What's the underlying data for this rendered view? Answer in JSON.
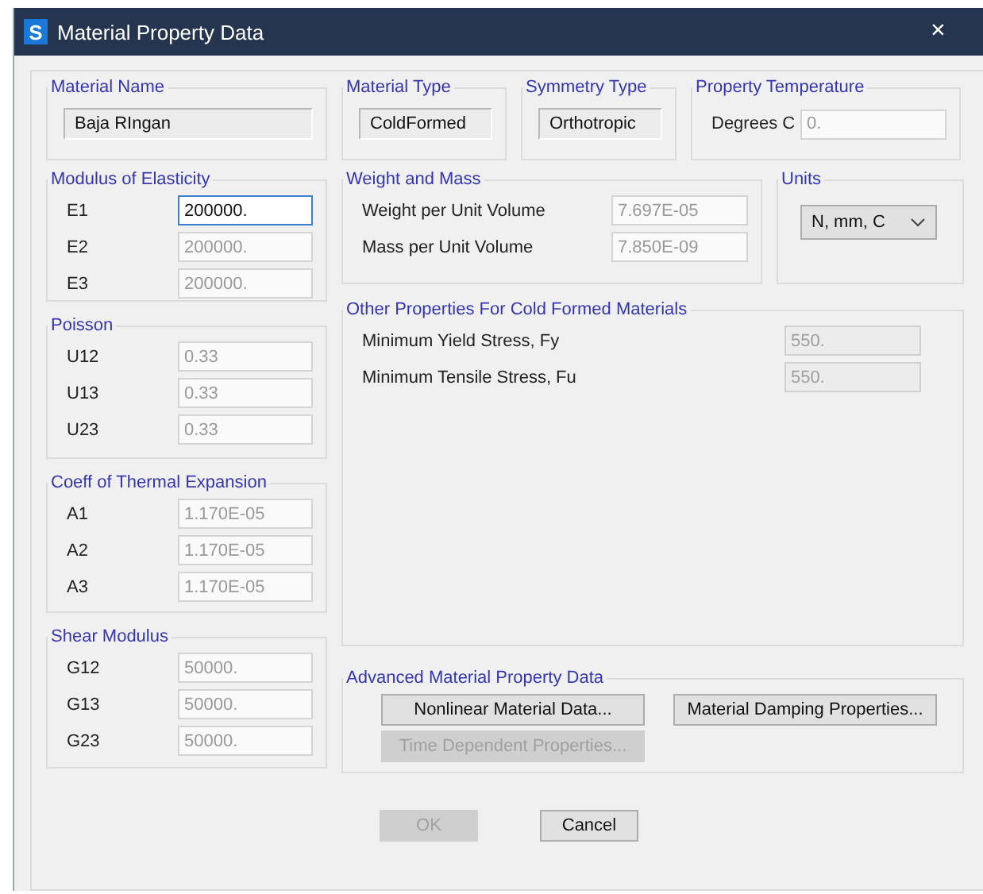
{
  "window": {
    "title": "Material Property Data",
    "close": "×",
    "logo": "S"
  },
  "top_groups": [
    {
      "title": "Material Name",
      "kind": "display",
      "value": "Baja RIngan"
    },
    {
      "title": "Material Type",
      "kind": "display",
      "value": "ColdFormed"
    },
    {
      "title": "Symmetry Type",
      "kind": "display",
      "value": "Orthotropic"
    },
    {
      "title": "Property Temperature",
      "kind": "input",
      "label": "Degrees C",
      "value": "0.",
      "disabled": true
    }
  ],
  "left_groups": [
    {
      "title": "Modulus of Elasticity",
      "rows": [
        {
          "label": "E1",
          "value": "200000.",
          "disabled": false,
          "focused": true
        },
        {
          "label": "E2",
          "value": "200000.",
          "disabled": true,
          "focused": false
        },
        {
          "label": "E3",
          "value": "200000.",
          "disabled": true,
          "focused": false
        }
      ]
    },
    {
      "title": "Poisson",
      "rows": [
        {
          "label": "U12",
          "value": "0.33",
          "disabled": true,
          "focused": false
        },
        {
          "label": "U13",
          "value": "0.33",
          "disabled": true,
          "focused": false
        },
        {
          "label": "U23",
          "value": "0.33",
          "disabled": true,
          "focused": false
        }
      ]
    },
    {
      "title": "Coeff of Thermal Expansion",
      "rows": [
        {
          "label": "A1",
          "value": "1.170E-05",
          "disabled": true,
          "focused": false
        },
        {
          "label": "A2",
          "value": "1.170E-05",
          "disabled": true,
          "focused": false
        },
        {
          "label": "A3",
          "value": "1.170E-05",
          "disabled": true,
          "focused": false
        }
      ]
    },
    {
      "title": "Shear Modulus",
      "rows": [
        {
          "label": "G12",
          "value": "50000.",
          "disabled": true,
          "focused": false
        },
        {
          "label": "G13",
          "value": "50000.",
          "disabled": true,
          "focused": false
        },
        {
          "label": "G23",
          "value": "50000.",
          "disabled": true,
          "focused": false
        }
      ]
    }
  ],
  "weight_and_mass": {
    "title": "Weight and Mass",
    "rows": [
      {
        "label": "Weight per Unit Volume",
        "value": "7.697E-05",
        "disabled": true
      },
      {
        "label": "Mass per Unit Volume",
        "value": "7.850E-09",
        "disabled": true
      }
    ]
  },
  "units": {
    "title": "Units",
    "value": "N, mm, C"
  },
  "cold_formed": {
    "title": "Other Properties For Cold Formed Materials",
    "rows": [
      {
        "label": "Minimum Yield Stress, Fy",
        "value": "550.",
        "disabled": true
      },
      {
        "label": "Minimum Tensile Stress, Fu",
        "value": "550.",
        "disabled": true
      }
    ]
  },
  "advanced": {
    "title": "Advanced Material Property Data",
    "buttons": [
      {
        "label": "Nonlinear Material Data...",
        "disabled": false
      },
      {
        "label": "Material Damping Properties...",
        "disabled": false
      },
      {
        "label": "Time Dependent Properties...",
        "disabled": true
      }
    ]
  },
  "buttons": [
    {
      "label": "OK",
      "disabled": true
    },
    {
      "label": "Cancel",
      "disabled": false
    }
  ]
}
